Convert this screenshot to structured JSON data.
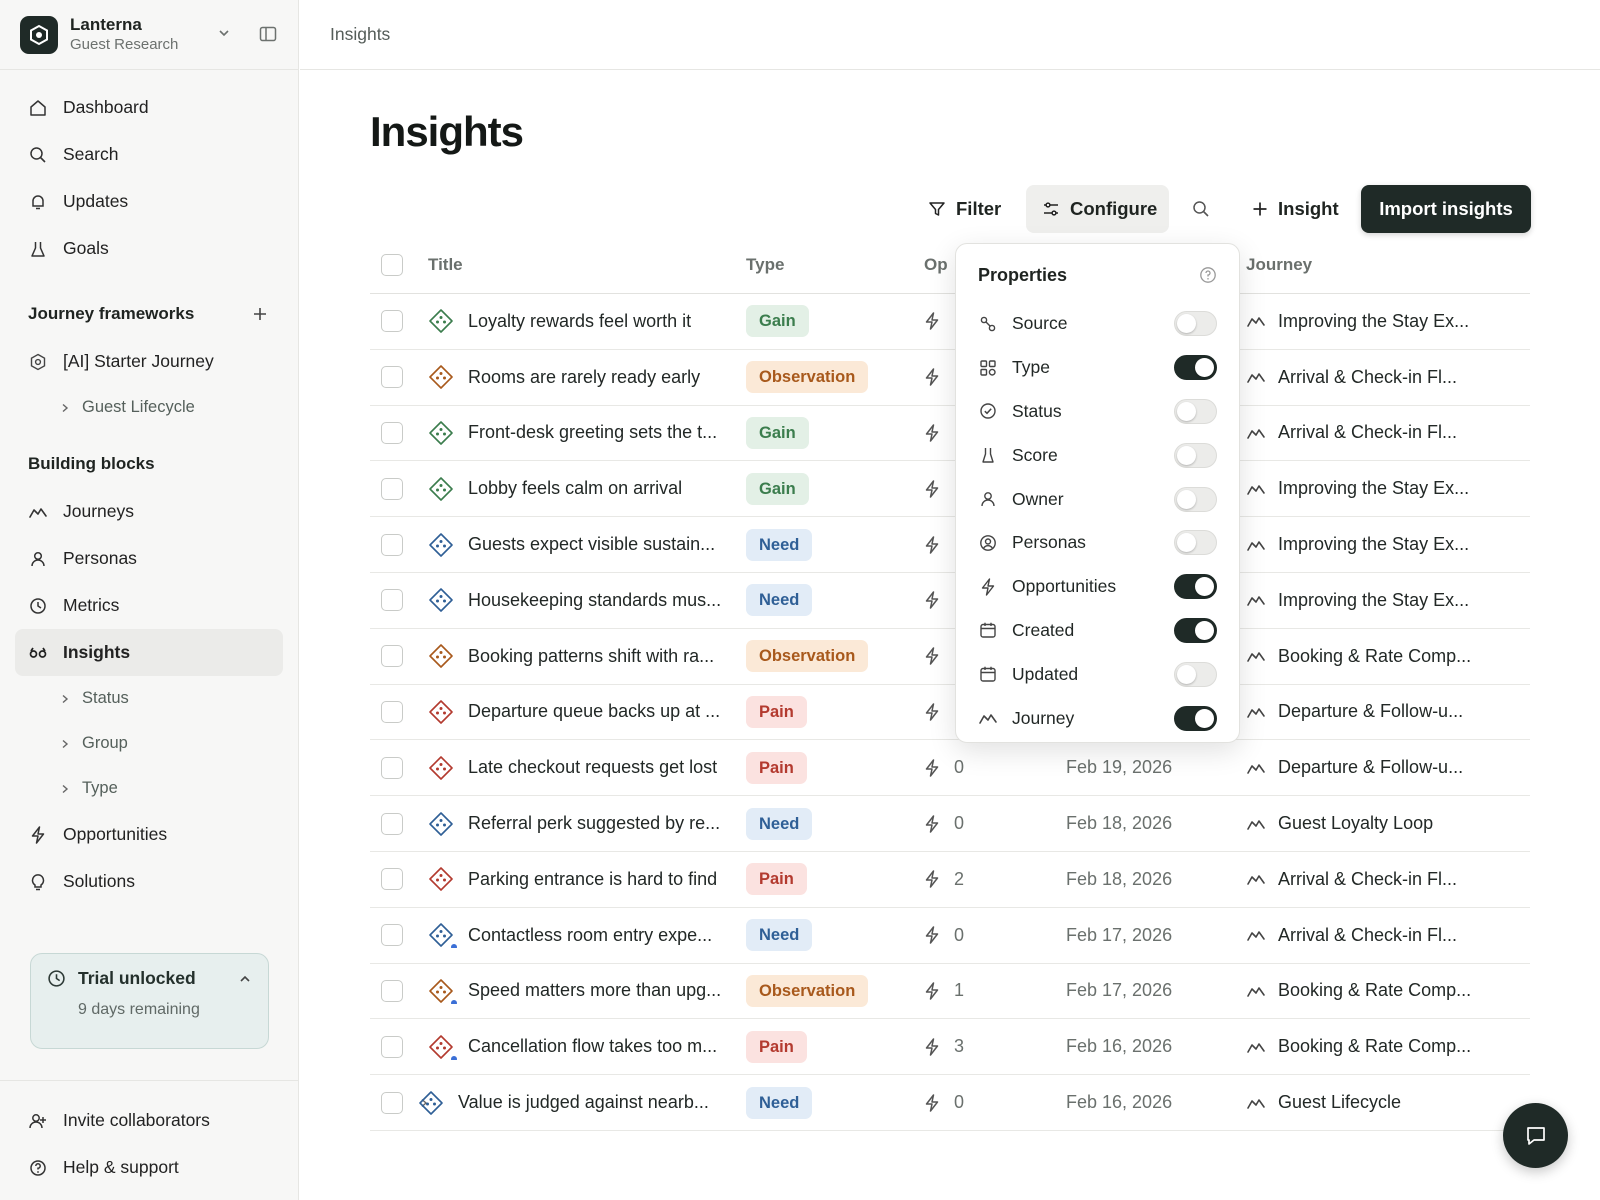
{
  "workspace": {
    "name": "Lanterna",
    "subtitle": "Guest Research"
  },
  "nav": {
    "dashboard": "Dashboard",
    "search": "Search",
    "updates": "Updates",
    "goals": "Goals",
    "frameworks_heading": "Journey frameworks",
    "starter_journey": "[AI] Starter Journey",
    "guest_lifecycle": "Guest Lifecycle",
    "building_blocks_heading": "Building blocks",
    "journeys": "Journeys",
    "personas": "Personas",
    "metrics": "Metrics",
    "insights": "Insights",
    "insights_sub": [
      "Status",
      "Group",
      "Type"
    ],
    "opportunities": "Opportunities",
    "solutions": "Solutions",
    "invite": "Invite collaborators",
    "help": "Help & support"
  },
  "trial": {
    "title": "Trial unlocked",
    "remaining": "9 days remaining"
  },
  "breadcrumb": "Insights",
  "page_title": "Insights",
  "toolbar": {
    "filter": "Filter",
    "configure": "Configure",
    "insight": "Insight",
    "import": "Import insights"
  },
  "table": {
    "columns": {
      "title": "Title",
      "type": "Type",
      "opportunities": "Op",
      "journey": "Journey"
    },
    "rows": [
      {
        "title": "Loyalty rewards feel worth it",
        "type": "Gain",
        "opps": "",
        "created": "",
        "journey": "Improving the Stay Ex...",
        "dot": false
      },
      {
        "title": "Rooms are rarely ready early",
        "type": "Observation",
        "opps": "",
        "created": "",
        "journey": "Arrival & Check-in Fl...",
        "dot": false
      },
      {
        "title": "Front-desk greeting sets the t...",
        "type": "Gain",
        "opps": "",
        "created": "",
        "journey": "Arrival & Check-in Fl...",
        "dot": false
      },
      {
        "title": "Lobby feels calm on arrival",
        "type": "Gain",
        "opps": "",
        "created": "",
        "journey": "Improving the Stay Ex...",
        "dot": false
      },
      {
        "title": "Guests expect visible sustain...",
        "type": "Need",
        "opps": "",
        "created": "",
        "journey": "Improving the Stay Ex...",
        "dot": false
      },
      {
        "title": "Housekeeping standards mus...",
        "type": "Need",
        "opps": "",
        "created": "",
        "journey": "Improving the Stay Ex...",
        "dot": false
      },
      {
        "title": "Booking patterns shift with ra...",
        "type": "Observation",
        "opps": "",
        "created": "",
        "journey": "Booking & Rate Comp...",
        "dot": false
      },
      {
        "title": "Departure queue backs up at ...",
        "type": "Pain",
        "opps": "",
        "created": "",
        "journey": "Departure & Follow-u...",
        "dot": false
      },
      {
        "title": "Late checkout requests get lost",
        "type": "Pain",
        "opps": "0",
        "created": "Feb 19, 2026",
        "journey": "Departure & Follow-u...",
        "dot": false
      },
      {
        "title": "Referral perk suggested by re...",
        "type": "Need",
        "opps": "0",
        "created": "Feb 18, 2026",
        "journey": "Guest Loyalty Loop",
        "dot": false
      },
      {
        "title": "Parking entrance is hard to find",
        "type": "Pain",
        "opps": "2",
        "created": "Feb 18, 2026",
        "journey": "Arrival & Check-in Fl...",
        "dot": false
      },
      {
        "title": "Contactless room entry expe...",
        "type": "Need",
        "opps": "0",
        "created": "Feb 17, 2026",
        "journey": "Arrival & Check-in Fl...",
        "dot": true
      },
      {
        "title": "Speed matters more than upg...",
        "type": "Observation",
        "opps": "1",
        "created": "Feb 17, 2026",
        "journey": "Booking & Rate Comp...",
        "dot": true
      },
      {
        "title": "Cancellation flow takes too m...",
        "type": "Pain",
        "opps": "3",
        "created": "Feb 16, 2026",
        "journey": "Booking & Rate Comp...",
        "dot": true
      },
      {
        "title": "Value is judged against nearb...",
        "type": "Need",
        "opps": "0",
        "created": "Feb 16, 2026",
        "journey": "Guest Lifecycle",
        "dot": false,
        "expandable": true
      }
    ]
  },
  "properties_popover": {
    "title": "Properties",
    "items": [
      {
        "label": "Source",
        "icon": "source-icon",
        "on": false
      },
      {
        "label": "Type",
        "icon": "type-icon",
        "on": true
      },
      {
        "label": "Status",
        "icon": "status-icon",
        "on": false
      },
      {
        "label": "Score",
        "icon": "score-icon",
        "on": false
      },
      {
        "label": "Owner",
        "icon": "owner-icon",
        "on": false
      },
      {
        "label": "Personas",
        "icon": "personas-icon",
        "on": false
      },
      {
        "label": "Opportunities",
        "icon": "opportunities-icon",
        "on": true
      },
      {
        "label": "Created",
        "icon": "calendar-icon",
        "on": true
      },
      {
        "label": "Updated",
        "icon": "calendar-icon",
        "on": false
      },
      {
        "label": "Journey",
        "icon": "journey-icon",
        "on": true
      }
    ]
  },
  "colors": {
    "gain": "#3b7d4d",
    "observation": "#a8591c",
    "need": "#2f5f96",
    "pain": "#b33a2f",
    "accent_dark": "#1f2a27"
  }
}
